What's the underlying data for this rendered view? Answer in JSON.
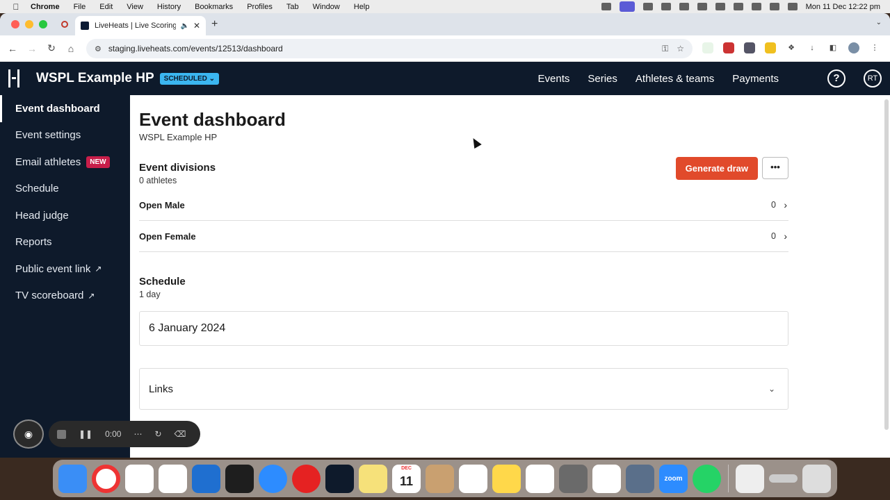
{
  "menubar": {
    "app_name": "Chrome",
    "items": [
      "File",
      "Edit",
      "View",
      "History",
      "Bookmarks",
      "Profiles",
      "Tab",
      "Window",
      "Help"
    ],
    "clock": "Mon 11 Dec  12:22 pm"
  },
  "browser": {
    "tab_title": "LiveHeats | Live Scoring a",
    "url": "staging.liveheats.com/events/12513/dashboard"
  },
  "app": {
    "event_name": "WSPL Example HP",
    "status": "SCHEDULED",
    "nav": [
      "Events",
      "Series",
      "Athletes & teams",
      "Payments"
    ],
    "help_label": "?",
    "avatar_initials": "RT"
  },
  "sidebar": {
    "items": [
      {
        "label": "Event dashboard"
      },
      {
        "label": "Event settings"
      },
      {
        "label": "Email athletes",
        "badge": "NEW"
      },
      {
        "label": "Schedule"
      },
      {
        "label": "Head judge"
      },
      {
        "label": "Reports"
      },
      {
        "label": "Public event link"
      },
      {
        "label": "TV scoreboard"
      }
    ]
  },
  "main": {
    "title": "Event dashboard",
    "subtitle": "WSPL Example HP",
    "divisions": {
      "title": "Event divisions",
      "subtitle": "0 athletes",
      "generate_label": "Generate draw",
      "more_label": "•••",
      "rows": [
        {
          "name": "Open Male",
          "count": "0"
        },
        {
          "name": "Open Female",
          "count": "0"
        }
      ]
    },
    "schedule": {
      "title": "Schedule",
      "subtitle": "1 day",
      "date": "6 January 2024"
    },
    "links": {
      "label": "Links"
    }
  },
  "recorder": {
    "time": "0:00"
  },
  "dock": {
    "calendar_month": "DEC",
    "calendar_day": "11",
    "zoom_label": "zoom"
  },
  "colors": {
    "nav_bg": "#0e1a2b",
    "status_badge": "#3bb6f0",
    "new_badge": "#c81e4a",
    "primary_button": "#e14a2b"
  }
}
